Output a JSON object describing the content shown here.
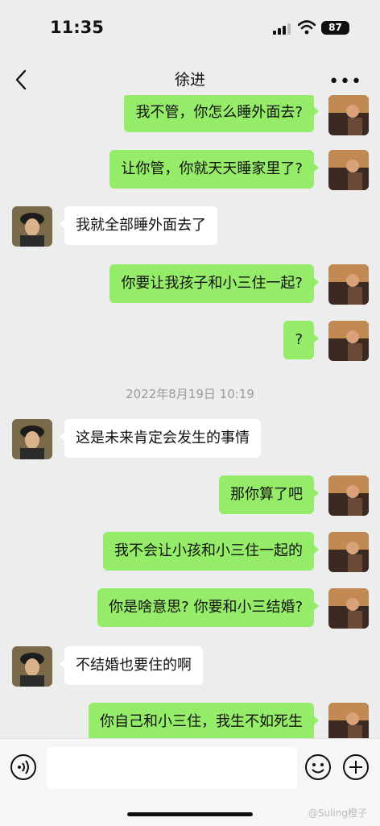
{
  "status_bar": {
    "time": "11:35",
    "battery": "87"
  },
  "nav": {
    "title": "徐进"
  },
  "messages": [
    {
      "side": "me",
      "text": "我不管，你怎么睡外面去?"
    },
    {
      "side": "me",
      "text": "让你管，你就天天睡家里了?"
    },
    {
      "side": "them",
      "text": "我就全部睡外面去了"
    },
    {
      "side": "me",
      "text": "你要让我孩子和小三住一起?"
    },
    {
      "side": "me",
      "text": "?"
    },
    {
      "type": "timestamp",
      "text": "2022年8月19日 10:19"
    },
    {
      "side": "them",
      "text": "这是未来肯定会发生的事情"
    },
    {
      "side": "me",
      "text": "那你算了吧"
    },
    {
      "side": "me",
      "text": "我不会让小孩和小三住一起的"
    },
    {
      "side": "me",
      "text": "你是啥意思? 你要和小三结婚?"
    },
    {
      "side": "them",
      "text": "不结婚也要住的啊"
    },
    {
      "side": "me",
      "text": "你自己和小三住，我生不如死生"
    }
  ],
  "input": {
    "placeholder": ""
  },
  "watermark": "@Suling橙子",
  "colors": {
    "my_bubble": "#95ec69",
    "their_bubble": "#ffffff",
    "background": "#ededed"
  },
  "icons": [
    "back-icon",
    "more-icon",
    "voice-icon",
    "emoji-icon",
    "plus-icon",
    "signal-icon",
    "wifi-icon"
  ]
}
